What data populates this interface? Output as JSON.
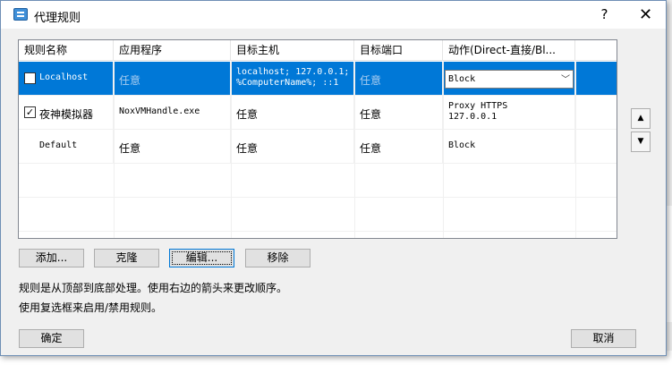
{
  "window": {
    "title": "代理规则",
    "help_glyph": "?",
    "close_glyph": "✕"
  },
  "table": {
    "columns": [
      "规则名称",
      "应用程序",
      "目标主机",
      "目标端口",
      "动作(Direct-直接/Bl..."
    ],
    "rows": [
      {
        "checked": false,
        "name": "Localhost",
        "app": "任意",
        "host_line1": "localhost; 127.0.0.1;",
        "host_line2": "%ComputerName%; ::1",
        "port": "任意",
        "action": "Block"
      },
      {
        "checked": true,
        "check_glyph": "✓",
        "name": "夜神模拟器",
        "app": "NoxVMHandle.exe",
        "host": "任意",
        "port": "任意",
        "action_line1": "Proxy HTTPS",
        "action_line2": "127.0.0.1"
      },
      {
        "name": "Default",
        "app": "任意",
        "host": "任意",
        "port": "任意",
        "action": "Block"
      }
    ],
    "combo_arrow": "﹀"
  },
  "reorder": {
    "up_glyph": "▲",
    "down_glyph": "▼"
  },
  "buttons": {
    "add": "添加...",
    "clone": "克隆",
    "edit": "编辑...",
    "remove": "移除",
    "ok": "确定",
    "cancel": "取消"
  },
  "notes": {
    "order": "规则是从顶部到底部处理。使用右边的箭头来更改顺序。",
    "checkbox": "使用复选框来启用/禁用规则。"
  },
  "colors": {
    "selection": "#0078d7",
    "dialog_bg": "#f0f0f0"
  }
}
